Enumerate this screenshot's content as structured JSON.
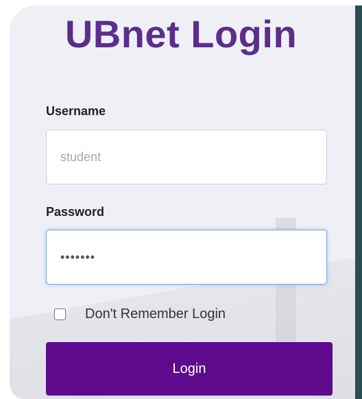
{
  "app": {
    "title": "UBnet Login"
  },
  "form": {
    "username_label": "Username",
    "username_placeholder": "student",
    "password_label": "Password",
    "password_value": "•••••••",
    "remember_label": "Don't Remember Login",
    "remember_checked": false,
    "login_button_label": "Login"
  },
  "colors": {
    "title": "#5c2d8a",
    "button": "#5e0a8c",
    "focus_border": "#7da7dc"
  }
}
